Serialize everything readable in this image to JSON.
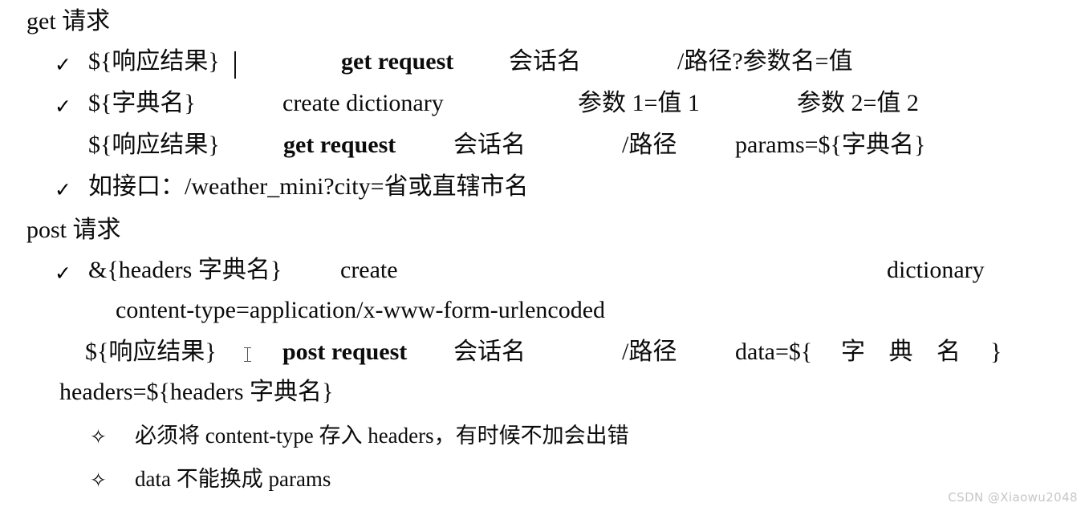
{
  "document": {
    "watermark": "CSDN @Xiaowu2048",
    "background_color": "#ffffff",
    "text_color": "#0b0b0b",
    "watermark_color": "#c6c6c6"
  },
  "sections": [
    {
      "heading": "get 请求",
      "lines": [
        {
          "bullet": "✓",
          "segments": [
            "${响应结果}",
            "get request",
            "会话名",
            "/路径?参数名=值"
          ]
        },
        {
          "bullet": "✓",
          "segments": [
            "${字典名}",
            "create dictionary",
            "参数 1=值 1",
            "参数 2=值 2"
          ]
        },
        {
          "bullet": "",
          "segments": [
            "${响应结果}",
            "get request",
            "会话名",
            "/路径",
            "params=${字典名}"
          ]
        },
        {
          "bullet": "✓",
          "segments": [
            "如接口：/weather_mini?city=省或直辖市名"
          ]
        }
      ]
    },
    {
      "heading": "post 请求",
      "lines": [
        {
          "bullet": "✓",
          "segments": [
            "&{headers 字典名}",
            "create",
            "dictionary"
          ]
        },
        {
          "bullet": "",
          "segments": [
            "content-type=application/x-www-form-urlencoded"
          ]
        },
        {
          "bullet": "",
          "segments": [
            "${响应结果}",
            "post request",
            "会话名",
            "/路径",
            "data=${",
            "字 典 名",
            "}"
          ]
        },
        {
          "bullet": "",
          "segments": [
            "headers=${headers 字典名}"
          ]
        }
      ],
      "notes": [
        {
          "bullet": "✧",
          "text": "必须将 content-type 存入 headers，有时候不加会出错"
        },
        {
          "bullet": "✧",
          "text": "data 不能换成 params"
        }
      ]
    }
  ]
}
